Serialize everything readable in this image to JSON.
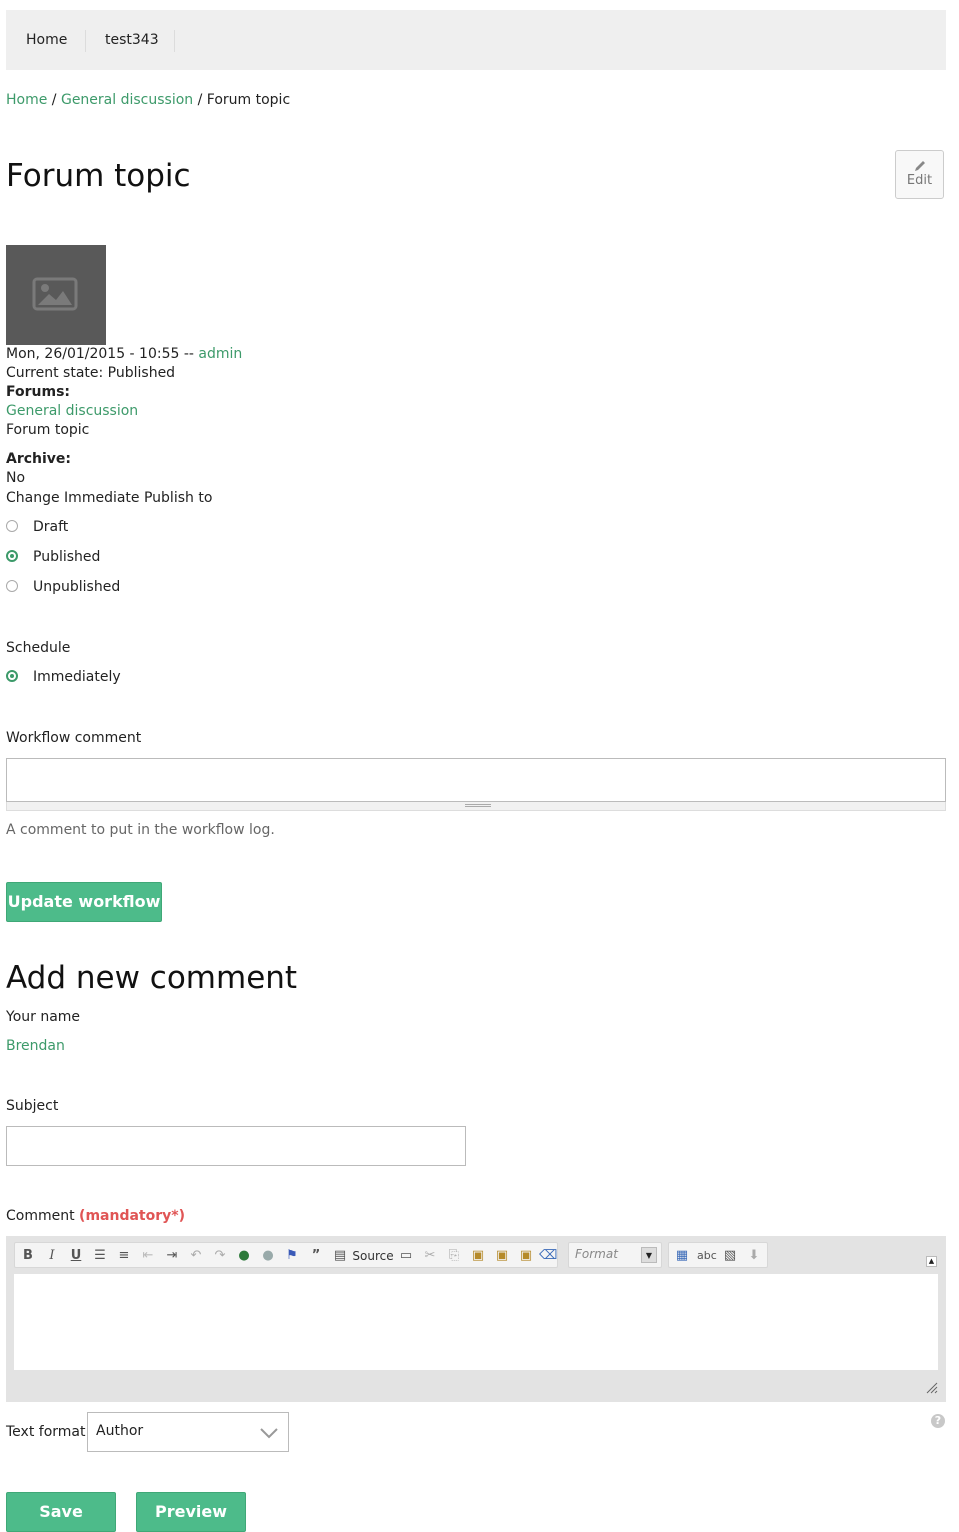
{
  "nav": {
    "items": [
      "Home",
      "test343"
    ]
  },
  "breadcrumb": {
    "home": "Home",
    "sep1": " / ",
    "forum": "General discussion",
    "sep2": " / ",
    "current": "Forum topic"
  },
  "page": {
    "title": "Forum topic",
    "edit_label": "Edit"
  },
  "meta": {
    "date": "Mon, 26/01/2015 - 10:55 -- ",
    "author": "admin",
    "state": "Current state: Published",
    "forums_label": "Forums:",
    "forum_link": "General discussion",
    "forum_item": "Forum topic",
    "archive_label": "Archive:",
    "archive_value": "No"
  },
  "workflow": {
    "change_label": "Change Immediate Publish to",
    "options": [
      "Draft",
      "Published",
      "Unpublished"
    ],
    "selected": "Published",
    "schedule_label": "Schedule",
    "schedule_option": "Immediately",
    "comment_label": "Workflow comment",
    "comment_value": "",
    "comment_desc": "A comment to put in the workflow log.",
    "update_button": "Update workflow"
  },
  "comment_form": {
    "heading": "Add new comment",
    "name_label": "Your name",
    "name_value": "Brendan",
    "subject_label": "Subject",
    "subject_value": "",
    "comment_label": "Comment",
    "mandatory": "(mandatory*)",
    "toolbar": {
      "source_label": "Source",
      "format_placeholder": "Format",
      "icons": [
        "bold-icon",
        "italic-icon",
        "underline-icon",
        "bulleted-list-icon",
        "numbered-list-icon",
        "outdent-icon",
        "indent-icon",
        "undo-icon",
        "redo-icon",
        "link-icon",
        "unlink-icon",
        "anchor-icon",
        "blockquote-icon",
        "source-icon",
        "horizontal-rule-icon",
        "cut-icon",
        "copy-icon",
        "paste-icon",
        "paste-text-icon",
        "paste-word-icon",
        "remove-format-icon",
        "table-icon",
        "spellcheck-icon",
        "image-icon",
        "download-icon"
      ]
    },
    "text_format_label": "Text format",
    "text_format_value": "Author",
    "save_button": "Save",
    "preview_button": "Preview"
  },
  "colors": {
    "accent": "#4dbb8a",
    "link": "#3d9a6a",
    "mandatory": "#e05555"
  }
}
